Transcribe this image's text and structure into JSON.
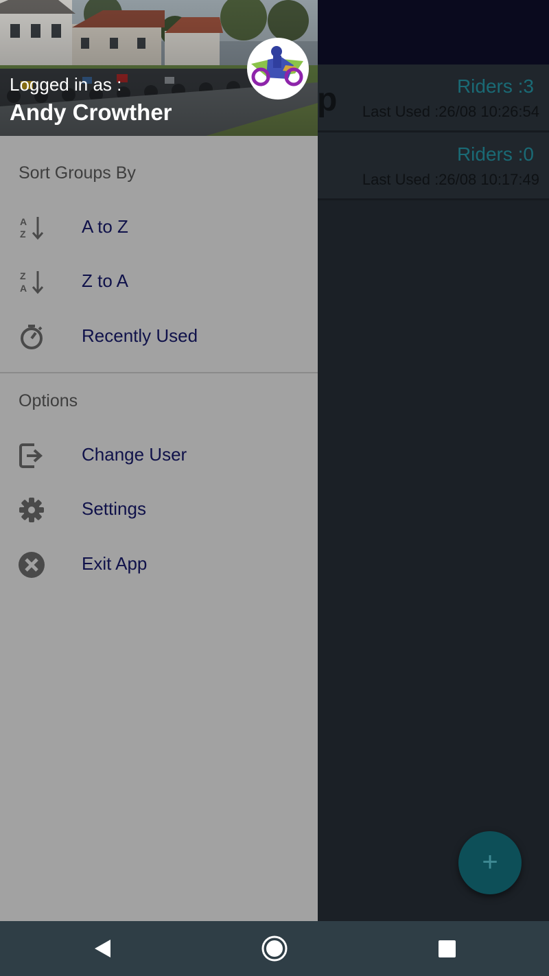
{
  "app": {
    "cards": [
      {
        "riders": "Riders :3",
        "last_used": "Last Used :26/08 10:26:54",
        "title_fragment": "p"
      },
      {
        "riders": "Riders :0",
        "last_used": "Last Used :26/08 10:17:49"
      }
    ],
    "fab_symbol": "+"
  },
  "drawer": {
    "header": {
      "logged_in_label": "Logged in as :",
      "user_name": "Andy Crowther",
      "avatar_icon": "motorcycle-rider-icon"
    },
    "sort_section": {
      "title": "Sort Groups By",
      "items": [
        {
          "label": "A to Z",
          "icon": "sort-a-z-icon"
        },
        {
          "label": "Z to A",
          "icon": "sort-z-a-icon"
        },
        {
          "label": "Recently Used",
          "icon": "timer-icon"
        }
      ]
    },
    "options_section": {
      "title": "Options",
      "items": [
        {
          "label": "Change User",
          "icon": "exit-to-app-icon"
        },
        {
          "label": "Settings",
          "icon": "gear-icon"
        },
        {
          "label": "Exit App",
          "icon": "close-circle-icon"
        }
      ]
    }
  },
  "system_nav": {
    "back_icon": "back-triangle-icon",
    "home_icon": "home-circle-icon",
    "recents_icon": "recents-square-icon"
  },
  "colors": {
    "drawer_bg": "#a2a2a2",
    "menu_label": "#10124a",
    "accent_teal": "#1a6a75",
    "system_nav_bg": "#2f3e46"
  }
}
